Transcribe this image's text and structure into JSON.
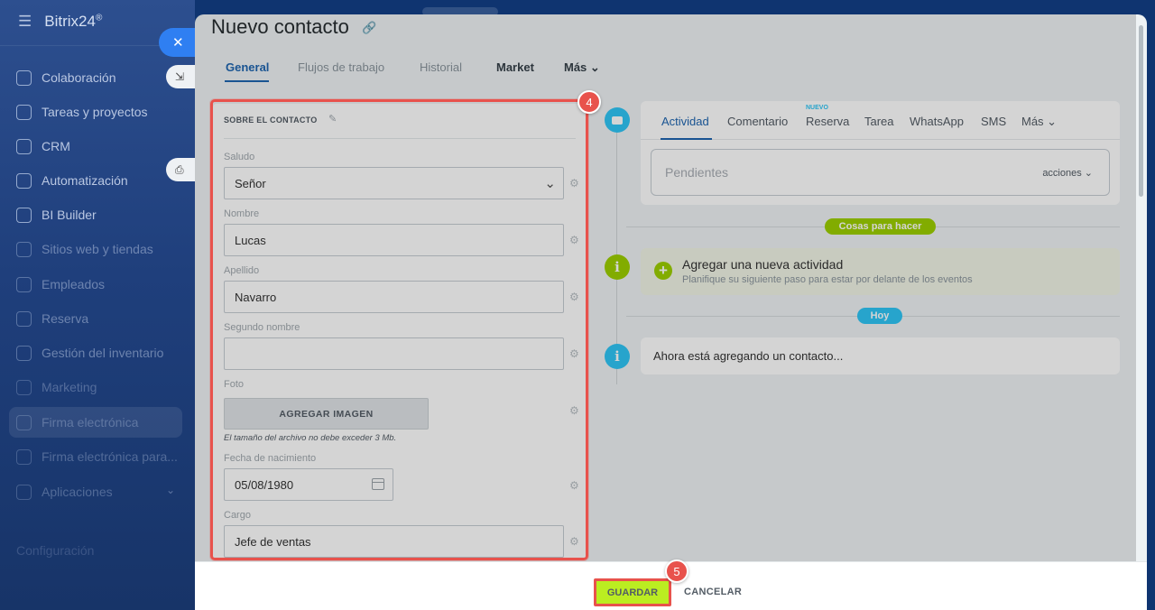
{
  "sidebar": {
    "logo": "Bitrix24",
    "logo_mark": "®",
    "items": [
      {
        "label": "Colaboración",
        "icon": "chat-bubbles-icon"
      },
      {
        "label": "Tareas y proyectos",
        "icon": "checkbox-icon"
      },
      {
        "label": "CRM",
        "icon": "filter-icon"
      },
      {
        "label": "Automatización",
        "icon": "robot-icon"
      },
      {
        "label": "BI Builder",
        "icon": "bar-chart-icon"
      },
      {
        "label": "Sitios web y tiendas",
        "icon": "cart-icon"
      },
      {
        "label": "Empleados",
        "icon": "people-icon"
      },
      {
        "label": "Reserva",
        "icon": "calendar-icon"
      },
      {
        "label": "Gestión del inventario",
        "icon": "box-icon"
      },
      {
        "label": "Marketing",
        "icon": "target-icon"
      },
      {
        "label": "Firma electrónica",
        "icon": "pen-icon"
      },
      {
        "label": "Firma electrónica para...",
        "icon": "document-sign-icon"
      },
      {
        "label": "Aplicaciones",
        "icon": "grid-icon"
      }
    ],
    "bottom_label": "Configuración"
  },
  "slider": {
    "close_icon": "close-icon",
    "expand_icon": "expand-icon",
    "print_icon": "print-icon"
  },
  "page": {
    "title": "Nuevo contacto",
    "tabs": [
      {
        "label": "General",
        "active": true
      },
      {
        "label": "Flujos de trabajo"
      },
      {
        "label": "Historial"
      },
      {
        "label": "Market"
      },
      {
        "label": "Más ⌄"
      }
    ]
  },
  "contact_form": {
    "section_title": "SOBRE EL CONTACTO",
    "fields": {
      "saludo": {
        "label": "Saludo",
        "value": "Señor"
      },
      "nombre": {
        "label": "Nombre",
        "value": "Lucas"
      },
      "apellido": {
        "label": "Apellido",
        "value": "Navarro"
      },
      "segundo_nombre": {
        "label": "Segundo nombre",
        "value": ""
      },
      "foto": {
        "label": "Foto",
        "button": "AGREGAR IMAGEN",
        "hint": "El tamaño del archivo no debe exceder 3 Mb."
      },
      "fecha": {
        "label": "Fecha de nacimiento",
        "value": "05/08/1980"
      },
      "cargo": {
        "label": "Cargo",
        "value": "Jefe de ventas"
      }
    }
  },
  "timeline": {
    "tabs": [
      {
        "label": "Actividad",
        "active": true
      },
      {
        "label": "Comentario"
      },
      {
        "label": "Reserva",
        "badge": "NUEVO"
      },
      {
        "label": "Tarea"
      },
      {
        "label": "WhatsApp"
      },
      {
        "label": "SMS"
      },
      {
        "label": "Más ⌄"
      }
    ],
    "pending_placeholder": "Pendientes",
    "pending_actions": "acciones ⌄",
    "todo_pill": "Cosas para hacer",
    "todo_title": "Agregar una nueva actividad",
    "todo_subtitle": "Planifique su siguiente paso para estar por delante de los eventos",
    "today_pill": "Hoy",
    "now_text": "Ahora está agregando un contacto..."
  },
  "footer": {
    "save": "GUARDAR",
    "cancel": "CANCELAR"
  },
  "annotations": {
    "badge_form": "4",
    "badge_save": "5"
  },
  "colors": {
    "accent_blue": "#2066b0",
    "annotation_red": "#e8524c",
    "save_green": "#bbed21",
    "timeline_green": "#9dcf00",
    "timeline_cyan": "#2fc6f6"
  }
}
